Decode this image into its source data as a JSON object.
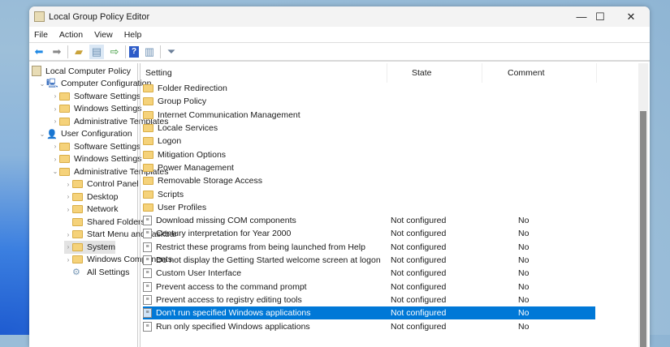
{
  "window": {
    "title": "Local Group Policy Editor",
    "minimize": "—",
    "maximize": "☐",
    "close": "✕"
  },
  "menu": [
    "File",
    "Action",
    "View",
    "Help"
  ],
  "tree": [
    {
      "label": "Local Computer Policy",
      "level": 0,
      "icon": "policy",
      "chev": ""
    },
    {
      "label": "Computer Configuration",
      "level": 1,
      "icon": "computer",
      "chev": "⌄"
    },
    {
      "label": "Software Settings",
      "level": 2,
      "icon": "folder",
      "chev": "›"
    },
    {
      "label": "Windows Settings",
      "level": 2,
      "icon": "folder",
      "chev": "›"
    },
    {
      "label": "Administrative Templates",
      "level": 2,
      "icon": "folder",
      "chev": "›"
    },
    {
      "label": "User Configuration",
      "level": 1,
      "icon": "user",
      "chev": "⌄"
    },
    {
      "label": "Software Settings",
      "level": 2,
      "icon": "folder",
      "chev": "›"
    },
    {
      "label": "Windows Settings",
      "level": 2,
      "icon": "folder",
      "chev": "›"
    },
    {
      "label": "Administrative Templates",
      "level": 2,
      "icon": "folder",
      "chev": "⌄"
    },
    {
      "label": "Control Panel",
      "level": 3,
      "icon": "folder",
      "chev": "›"
    },
    {
      "label": "Desktop",
      "level": 3,
      "icon": "folder",
      "chev": "›"
    },
    {
      "label": "Network",
      "level": 3,
      "icon": "folder",
      "chev": "›"
    },
    {
      "label": "Shared Folders",
      "level": 3,
      "icon": "folder",
      "chev": ""
    },
    {
      "label": "Start Menu and Taskbar",
      "level": 3,
      "icon": "folder",
      "chev": "›"
    },
    {
      "label": "System",
      "level": 3,
      "icon": "folder",
      "chev": "›",
      "selected": true
    },
    {
      "label": "Windows Components",
      "level": 3,
      "icon": "folder",
      "chev": "›"
    },
    {
      "label": "All Settings",
      "level": 3,
      "icon": "settings",
      "chev": ""
    }
  ],
  "columns": {
    "setting": "Setting",
    "state": "State",
    "comment": "Comment"
  },
  "rows": [
    {
      "name": "Folder Redirection",
      "type": "folder"
    },
    {
      "name": "Group Policy",
      "type": "folder"
    },
    {
      "name": "Internet Communication Management",
      "type": "folder"
    },
    {
      "name": "Locale Services",
      "type": "folder"
    },
    {
      "name": "Logon",
      "type": "folder"
    },
    {
      "name": "Mitigation Options",
      "type": "folder"
    },
    {
      "name": "Power Management",
      "type": "folder"
    },
    {
      "name": "Removable Storage Access",
      "type": "folder"
    },
    {
      "name": "Scripts",
      "type": "folder"
    },
    {
      "name": "User Profiles",
      "type": "folder"
    },
    {
      "name": "Download missing COM components",
      "type": "policy",
      "state": "Not configured",
      "comment": "No"
    },
    {
      "name": "Century interpretation for Year 2000",
      "type": "policy",
      "state": "Not configured",
      "comment": "No"
    },
    {
      "name": "Restrict these programs from being launched from Help",
      "type": "policy",
      "state": "Not configured",
      "comment": "No"
    },
    {
      "name": "Do not display the Getting Started welcome screen at logon",
      "type": "policy",
      "state": "Not configured",
      "comment": "No"
    },
    {
      "name": "Custom User Interface",
      "type": "policy",
      "state": "Not configured",
      "comment": "No"
    },
    {
      "name": "Prevent access to the command prompt",
      "type": "policy",
      "state": "Not configured",
      "comment": "No"
    },
    {
      "name": "Prevent access to registry editing tools",
      "type": "policy",
      "state": "Not configured",
      "comment": "No"
    },
    {
      "name": "Don't run specified Windows applications",
      "type": "policy",
      "state": "Not configured",
      "comment": "No",
      "selected": true
    },
    {
      "name": "Run only specified Windows applications",
      "type": "policy",
      "state": "Not configured",
      "comment": "No"
    }
  ],
  "colors": {
    "selection": "#0078d7"
  }
}
